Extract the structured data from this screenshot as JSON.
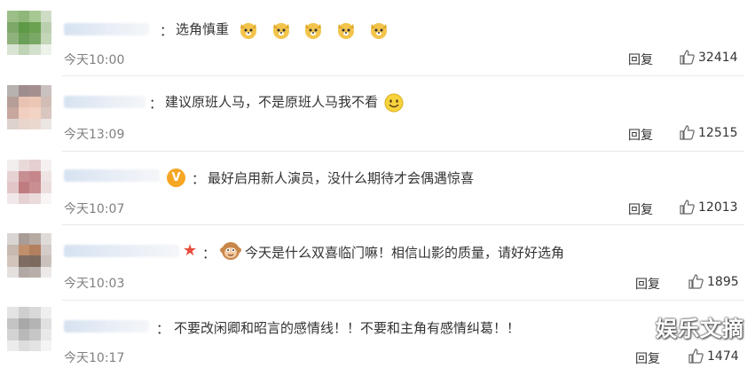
{
  "comments": [
    {
      "text": "选角慎重",
      "emoji": "dog-face-emoji",
      "emoji_count": 5,
      "time": "今天10:00",
      "reply": "回复",
      "likes": "32414"
    },
    {
      "text": "建议原班人马，不是原班人马我不看",
      "emoji": "smile-emoji",
      "time": "今天13:09",
      "reply": "回复",
      "likes": "12515"
    },
    {
      "text": "最好启用新人演员，没什么期待才会偶遇惊喜",
      "badge": "V",
      "time": "今天10:07",
      "reply": "回复",
      "likes": "12013"
    },
    {
      "text": "今天是什么双喜临门嘛！相信山影的质量，请好好选角",
      "emoji": "monkey-emoji",
      "time": "今天10:03",
      "reply": "回复",
      "likes": "1895"
    },
    {
      "text": "不要改闲卿和昭言的感情线！！不要和主角有感情纠葛！！",
      "time": "今天10:17",
      "reply": "回复",
      "likes": "1474"
    }
  ],
  "colon": "：",
  "watermark": "娱乐文摘",
  "colors": {
    "time": "#808080",
    "badge": "#f5a623",
    "star": "#e74c3c",
    "divider": "#e8e8e8"
  },
  "icons": {
    "like": "thumbs-up-icon",
    "verified": "verified-badge-icon",
    "star": "star-icon"
  }
}
